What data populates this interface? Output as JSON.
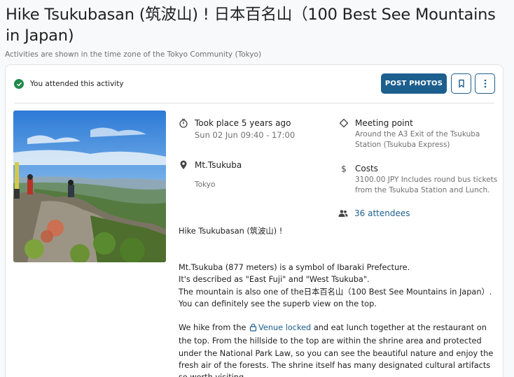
{
  "page": {
    "title": "Hike Tsukubasan (筑波山) ! 日本百名山（100 Best See Mountains in Japan)",
    "timezone_note": "Activities are shown in the time zone of the Tokyo Community (Tokyo)"
  },
  "card": {
    "attended_text": "You attended this activity",
    "post_photos_label": "POST PHOTOS"
  },
  "details": {
    "time_title": "Took place 5 years ago",
    "time_sub": "Sun 02 Jun 09:40 - 17:00",
    "location_title": "Mt.Tsukuba",
    "location_sub": "Tokyo",
    "meeting_title": "Meeting point",
    "meeting_detail": "Around the A3 Exit of the Tsukuba Station (Tsukuba Express)",
    "costs_title": "Costs",
    "costs_detail": "3100.00 JPY Includes round bus tickets from the Tsukuba Station and Lunch.",
    "attendees": "36 attendees"
  },
  "description": {
    "intro": "Hike Tsukubasan (筑波山) !",
    "p1_l1": "Mt.Tsukuba (877 meters) is a symbol of Ibaraki Prefecture.",
    "p1_l2": "It's described as \"East Fuji\" and \"West Tsukuba\".",
    "p1_l3": "The mountain is also one of the日本百名山（100 Best See Mountains in Japan）. You can definitely see the superb view on the top.",
    "p2_start": "We hike from the",
    "venue_locked": "Venue locked",
    "p2_rest": "and eat lunch together at the restaurant on the top. From the hillside to the top are within the shrine area and protected under the National Park Law, so you can see the beautiful nature and enjoy the fresh air of the forests. The shrine itself has many designated cultural artifacts so worth visiting."
  },
  "icons": {
    "attended": "check-circle-icon",
    "bookmark": "bookmark-icon",
    "more": "more-vertical-icon",
    "time": "stopwatch-icon",
    "location": "map-pin-icon",
    "meeting": "meeting-point-icon",
    "costs": "dollar-icon",
    "attendees": "people-icon",
    "venue": "lock-icon"
  },
  "colors": {
    "accent": "#1c5f8e",
    "success": "#1f8a4c",
    "muted_text": "#707070"
  }
}
